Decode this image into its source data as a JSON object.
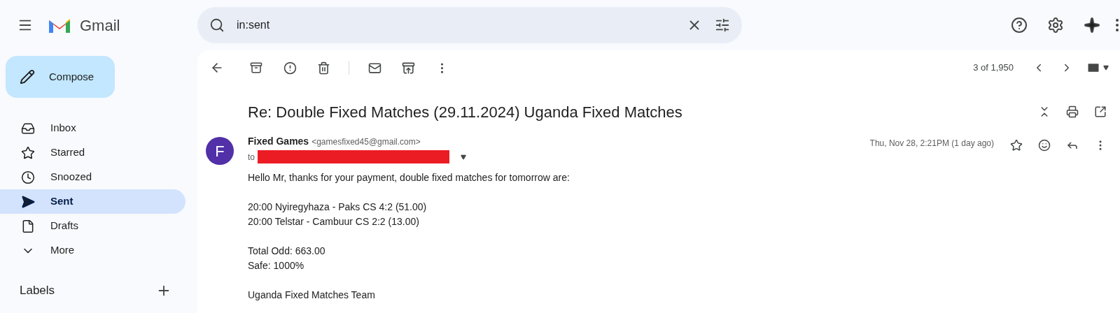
{
  "app": {
    "name": "Gmail"
  },
  "search": {
    "value": "in:sent"
  },
  "compose": {
    "label": "Compose"
  },
  "sidebar": {
    "items": [
      {
        "kind": "inbox",
        "label": "Inbox",
        "selected": false
      },
      {
        "kind": "starred",
        "label": "Starred",
        "selected": false
      },
      {
        "kind": "snoozed",
        "label": "Snoozed",
        "selected": false
      },
      {
        "kind": "sent",
        "label": "Sent",
        "selected": true
      },
      {
        "kind": "drafts",
        "label": "Drafts",
        "selected": false
      },
      {
        "kind": "more",
        "label": "More",
        "selected": false
      }
    ],
    "labels_heading": "Labels"
  },
  "pager": {
    "text": "3 of 1,950"
  },
  "message": {
    "subject": "Re: Double Fixed Matches (29.11.2024) Uganda Fixed Matches",
    "avatar_letter": "F",
    "sender_name": "Fixed Games",
    "sender_email": "<gamesfixed45@gmail.com>",
    "to_label": "to",
    "date": "Thu, Nov 28, 2:21PM (1 day ago)",
    "body": [
      [
        "Hello Mr, thanks for your payment, double fixed matches for tomorrow are:"
      ],
      [
        "20:00 Nyiregyhaza - Paks CS 4:2 (51.00)",
        "20:00 Telstar - Cambuur CS 2:2 (13.00)"
      ],
      [
        "Total Odd: 663.00",
        "Safe: 1000%"
      ],
      [
        "Uganda Fixed Matches Team"
      ]
    ]
  }
}
